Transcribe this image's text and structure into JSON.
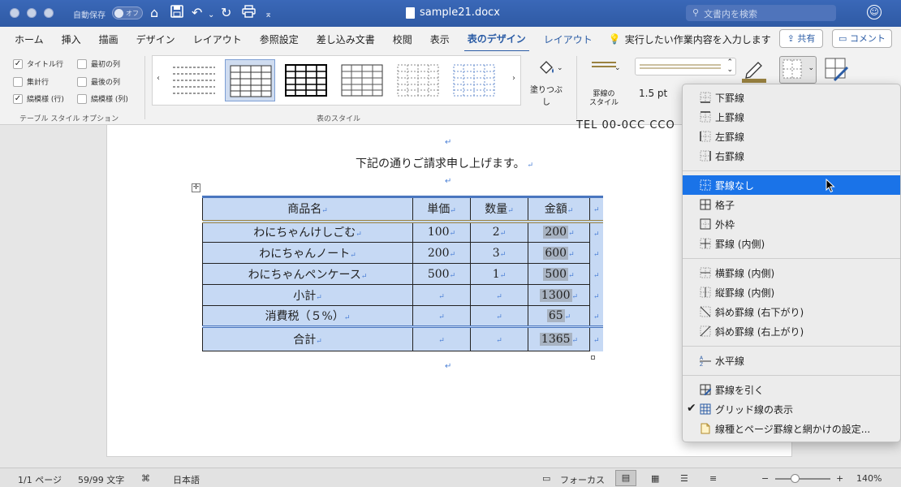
{
  "titlebar": {
    "autosave_label": "自動保存",
    "autosave_state": "オフ",
    "document_title": "sample21.docx",
    "search_placeholder": "文書内を検索"
  },
  "tabs": [
    {
      "label": "ホーム"
    },
    {
      "label": "挿入"
    },
    {
      "label": "描画"
    },
    {
      "label": "デザイン"
    },
    {
      "label": "レイアウト"
    },
    {
      "label": "参照設定"
    },
    {
      "label": "差し込み文書"
    },
    {
      "label": "校閲"
    },
    {
      "label": "表示"
    },
    {
      "label": "表のデザイン",
      "active": true
    },
    {
      "label": "レイアウト"
    }
  ],
  "tell_me": "実行したい作業内容を入力します",
  "share_label": "共有",
  "comment_label": "コメント",
  "ribbon": {
    "options": [
      {
        "label": "タイトル行",
        "checked": true
      },
      {
        "label": "最初の列",
        "checked": false
      },
      {
        "label": "集計行",
        "checked": false
      },
      {
        "label": "最後の列",
        "checked": false
      },
      {
        "label": "縞模様 (行)",
        "checked": true
      },
      {
        "label": "縞模様 (列)",
        "checked": false
      }
    ],
    "options_group_label": "テーブル スタイル オプション",
    "styles_group_label": "表のスタイル",
    "fill_label": "塗りつぶし",
    "border_style_label": "罫線の\nスタイル",
    "weight_value": "1.5 pt"
  },
  "document": {
    "tel_line": "TEL  00-0CC  CCO",
    "intro": "下記の通りご請求申し上げます。",
    "table": {
      "header": [
        "商品名",
        "単価",
        "数量",
        "金額"
      ],
      "rows": [
        [
          "わにちゃんけしごむ",
          "100",
          "2",
          "200"
        ],
        [
          "わにちゃんノート",
          "200",
          "3",
          "600"
        ],
        [
          "わにちゃんペンケース",
          "500",
          "1",
          "500"
        ],
        [
          "小計",
          "",
          "",
          "1300"
        ],
        [
          "消費税（５%）",
          "",
          "",
          "65"
        ]
      ],
      "total": [
        "合計",
        "",
        "",
        "1365"
      ]
    }
  },
  "borders_menu": {
    "items": [
      {
        "label": "下罫線",
        "icon": "border-bottom-icon"
      },
      {
        "label": "上罫線",
        "icon": "border-top-icon"
      },
      {
        "label": "左罫線",
        "icon": "border-left-icon"
      },
      {
        "label": "右罫線",
        "icon": "border-right-icon"
      },
      {
        "label": "罫線なし",
        "icon": "no-border-icon",
        "highlighted": true
      },
      {
        "label": "格子",
        "icon": "all-borders-icon"
      },
      {
        "label": "外枠",
        "icon": "outside-borders-icon"
      },
      {
        "label": "罫線 (内側)",
        "icon": "inside-borders-icon"
      },
      {
        "label": "横罫線 (内側)",
        "icon": "inside-horizontal-icon"
      },
      {
        "label": "縦罫線 (内側)",
        "icon": "inside-vertical-icon"
      },
      {
        "label": "斜め罫線 (右下がり)",
        "icon": "diagonal-down-icon"
      },
      {
        "label": "斜め罫線 (右上がり)",
        "icon": "diagonal-up-icon"
      },
      {
        "label": "水平線",
        "icon": "horizontal-line-icon"
      },
      {
        "label": "罫線を引く",
        "icon": "draw-table-icon"
      },
      {
        "label": "グリッド線の表示",
        "icon": "view-gridlines-icon",
        "checked": true
      },
      {
        "label": "線種とページ罫線と網かけの設定...",
        "icon": "borders-shading-icon"
      }
    ]
  },
  "statusbar": {
    "page": "1/1 ページ",
    "words": "59/99 文字",
    "language": "日本語",
    "focus": "フォーカス",
    "zoom": "140%",
    "zoom_level": 0.35
  },
  "colors": {
    "title_bar": "#2f5aa4",
    "accent": "#2b5ca5",
    "table_fill": "#c6d9f4",
    "menu_highlight": "#1a73e8"
  }
}
